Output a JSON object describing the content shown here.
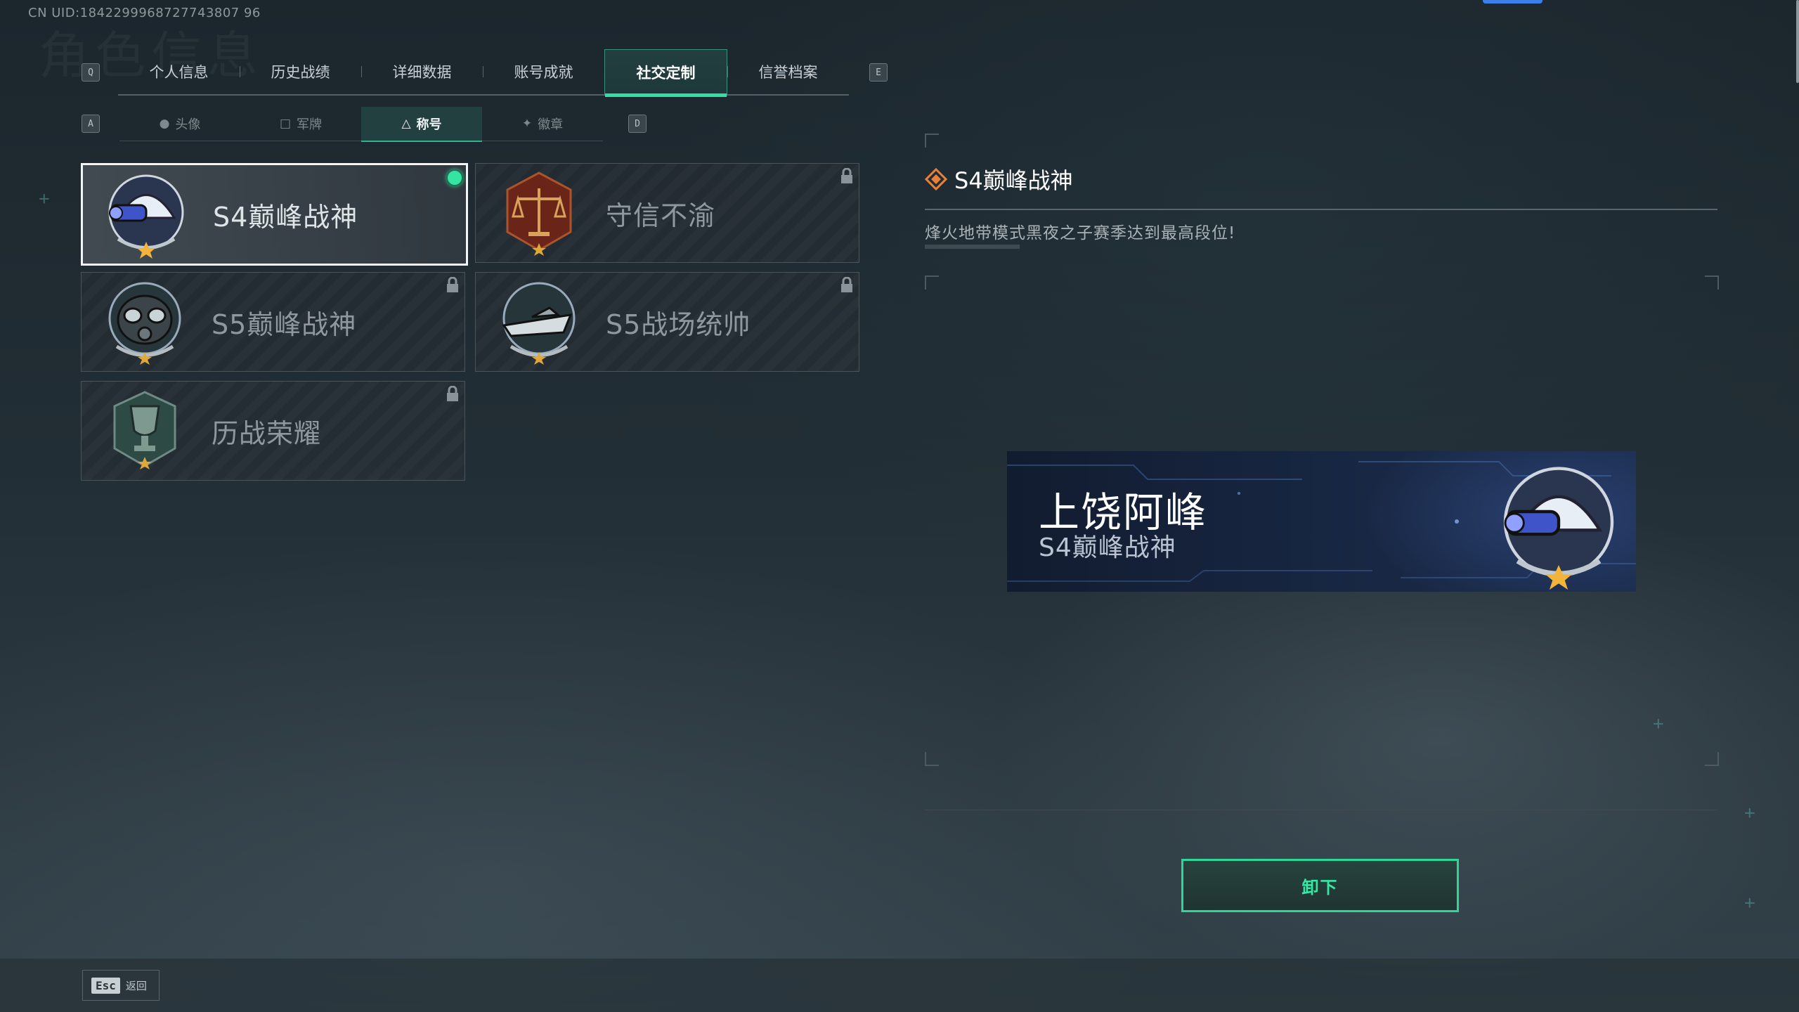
{
  "header": {
    "uid": "CN UID:1842299968727743807 96",
    "ghost_title": "角色信息"
  },
  "tabs": {
    "prev_key": "Q",
    "next_key": "E",
    "items": [
      {
        "label": "个人信息"
      },
      {
        "label": "历史战绩"
      },
      {
        "label": "详细数据"
      },
      {
        "label": "账号成就"
      },
      {
        "label": "社交定制"
      },
      {
        "label": "信誉档案"
      }
    ],
    "active_index": 4
  },
  "subtabs": {
    "prev_key": "A",
    "next_key": "D",
    "items": [
      {
        "label": "头像",
        "icon": "person-icon"
      },
      {
        "label": "军牌",
        "icon": "dogtag-icon"
      },
      {
        "label": "称号",
        "icon": "title-icon"
      },
      {
        "label": "徽章",
        "icon": "emblem-icon"
      }
    ],
    "active_index": 2
  },
  "titles": [
    {
      "name": "S4巅峰战神",
      "badge": "helmet-nightvision-badge",
      "equipped": true,
      "locked": false
    },
    {
      "name": "守信不渝",
      "badge": "scales-badge",
      "equipped": false,
      "locked": true
    },
    {
      "name": "S5巅峰战神",
      "badge": "gasmask-badge",
      "equipped": false,
      "locked": true
    },
    {
      "name": "S5战场统帅",
      "badge": "speedboat-badge",
      "equipped": false,
      "locked": true
    },
    {
      "name": "历战荣耀",
      "badge": "trophy-badge",
      "equipped": false,
      "locked": true
    }
  ],
  "detail": {
    "title": "S4巅峰战神",
    "description": "烽火地带模式黑夜之子赛季达到最高段位!"
  },
  "preview": {
    "player_name": "上饶阿峰",
    "title": "S4巅峰战神"
  },
  "actions": {
    "unequip_label": "卸下",
    "esc_key": "Esc",
    "back_label": "返回"
  },
  "colors": {
    "accent_green": "#2fe2a4",
    "equipped_dot": "#35e4a0",
    "detail_icon": "#e8803a",
    "top_indicator": "#3d7fe8"
  }
}
